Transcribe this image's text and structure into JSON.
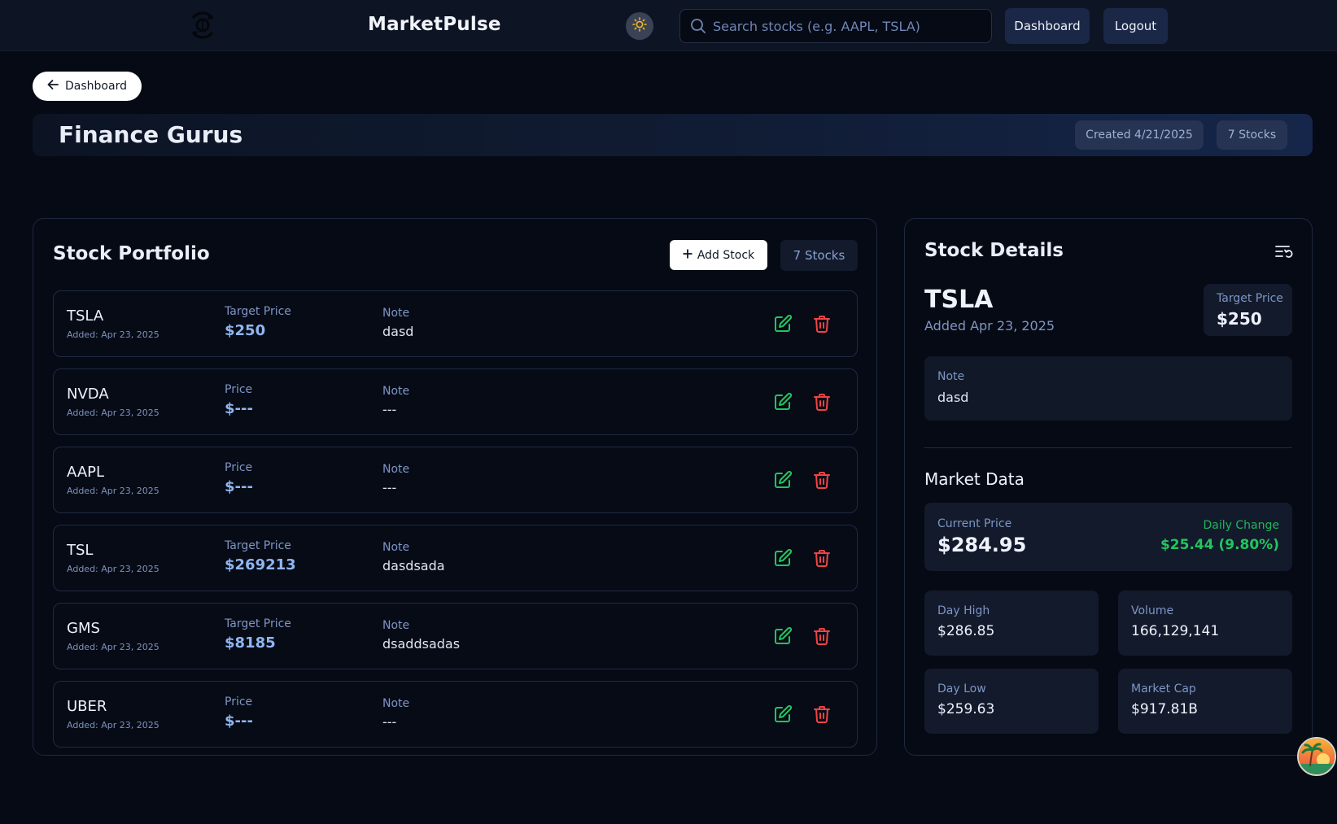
{
  "topnav": {
    "brand": "MarketPulse",
    "search_placeholder": "Search stocks (e.g. AAPL, TSLA)",
    "dashboard_label": "Dashboard",
    "logout_label": "Logout"
  },
  "header": {
    "back_label": "Dashboard",
    "group_title": "Finance Gurus",
    "created": "Created 4/21/2025",
    "stock_count": "7 Stocks"
  },
  "portfolio": {
    "title": "Stock Portfolio",
    "add_label": "Add Stock",
    "count": "7 Stocks",
    "rows": [
      {
        "symbol": "TSLA",
        "added": "Added: Apr 23, 2025",
        "price_label": "Target Price",
        "price": "$250",
        "note_label": "Note",
        "note": "dasd"
      },
      {
        "symbol": "NVDA",
        "added": "Added: Apr 23, 2025",
        "price_label": "Price",
        "price": "$---",
        "note_label": "Note",
        "note": "---"
      },
      {
        "symbol": "AAPL",
        "added": "Added: Apr 23, 2025",
        "price_label": "Price",
        "price": "$---",
        "note_label": "Note",
        "note": "---"
      },
      {
        "symbol": "TSL",
        "added": "Added: Apr 23, 2025",
        "price_label": "Target Price",
        "price": "$269213",
        "note_label": "Note",
        "note": "dasdsada"
      },
      {
        "symbol": "GMS",
        "added": "Added: Apr 23, 2025",
        "price_label": "Target Price",
        "price": "$8185",
        "note_label": "Note",
        "note": "dsaddsadas"
      },
      {
        "symbol": "UBER",
        "added": "Added: Apr 23, 2025",
        "price_label": "Price",
        "price": "$---",
        "note_label": "Note",
        "note": "---"
      }
    ]
  },
  "details": {
    "title": "Stock Details",
    "symbol": "TSLA",
    "added": "Added Apr 23, 2025",
    "target_label": "Target Price",
    "target": "$250",
    "note_label": "Note",
    "note": "dasd",
    "market_title": "Market Data",
    "current_price_label": "Current Price",
    "current_price": "$284.95",
    "daily_change_label": "Daily Change",
    "daily_change": "$25.44 (9.80%)",
    "day_high_label": "Day High",
    "day_high": "$286.85",
    "volume_label": "Volume",
    "volume": "166,129,141",
    "day_low_label": "Day Low",
    "day_low": "$259.63",
    "market_cap_label": "Market Cap",
    "market_cap": "$917.81B"
  },
  "colors": {
    "background": "#060a14",
    "nav": "#0d1424",
    "accent_blue": "#8fb6f0",
    "edit_green": "#22c55e",
    "delete_red": "#ef4444",
    "positive": "#22c55e"
  },
  "icons": {
    "logo": "refresh-dollar-icon",
    "theme": "sun-icon",
    "search": "search-icon",
    "back": "arrow-left-icon",
    "add": "plus-icon",
    "edit": "edit-icon",
    "delete": "trash-icon",
    "reset": "list-reset-icon"
  }
}
